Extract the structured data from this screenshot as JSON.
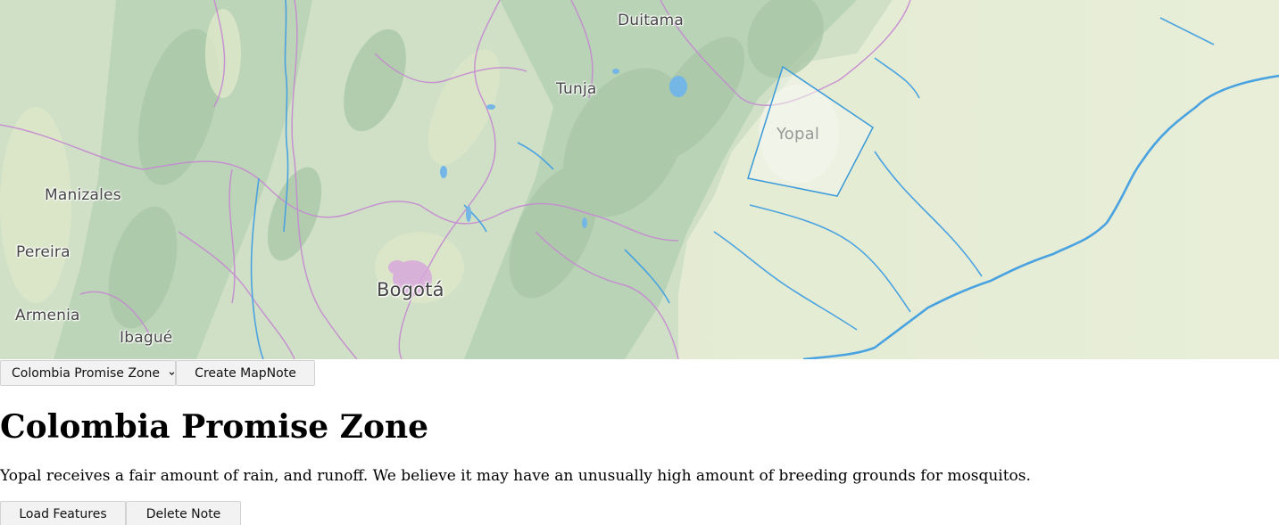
{
  "map": {
    "cities": [
      {
        "key": "duitama",
        "label": "Duitama"
      },
      {
        "key": "tunja",
        "label": "Tunja"
      },
      {
        "key": "manizales",
        "label": "Manizales"
      },
      {
        "key": "pereira",
        "label": "Pereira"
      },
      {
        "key": "bogota",
        "label": "Bogotá"
      },
      {
        "key": "armenia",
        "label": "Armenia"
      },
      {
        "key": "ibague",
        "label": "Ibagué"
      },
      {
        "key": "yopal",
        "label": "Yopal"
      }
    ],
    "zone_color": "#3a9ad9",
    "river_color": "#4aa3e0",
    "border_color": "#c58ad1"
  },
  "toolbar": {
    "zone_select_value": "Colombia Promise Zone",
    "zone_select_icon": "chevron-down-icon",
    "create_label": "Create MapNote"
  },
  "note": {
    "title": "Colombia Promise Zone",
    "description": "Yopal receives a fair amount of rain, and runoff. We believe it may have an unusually high amount of breeding grounds for mosquitos."
  },
  "actions": {
    "load_label": "Load Features",
    "delete_label": "Delete Note"
  }
}
